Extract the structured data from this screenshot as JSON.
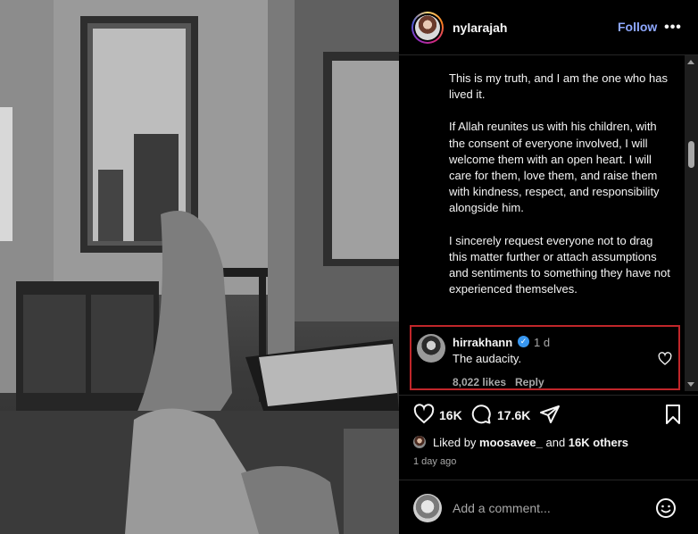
{
  "post": {
    "username": "nylarajah",
    "follow_label": "Follow",
    "more_label": "•••",
    "caption": [
      "This is my truth, and I am the one who has lived it.",
      "If Allah reunites us with his children, with the consent of everyone involved, I will welcome them with an open heart. I will care for them, love them, and raise them with kindness, respect, and responsibility alongside him.",
      "I sincerely request everyone not to drag this matter further or attach assumptions and sentiments to something they have not experienced themselves."
    ]
  },
  "comment": {
    "username": "hirrakhann",
    "verified_mark": "✓",
    "time": "1 d",
    "text": "The audacity.",
    "likes": "8,022 likes",
    "reply_label": "Reply"
  },
  "actions": {
    "like_count": "16K",
    "comment_count": "17.6K"
  },
  "liked_by": {
    "prefix": "Liked by ",
    "user": "moosavee_",
    "mid": " and ",
    "others": "16K others"
  },
  "date": "1 day ago",
  "add_comment": {
    "placeholder": "Add a comment..."
  },
  "colors": {
    "follow": "#8ea8ff",
    "highlight_border": "#c0262a",
    "verified": "#3897f0"
  },
  "icons": [
    "more-icon",
    "heart-icon",
    "comment-icon",
    "share-icon",
    "bookmark-icon",
    "emoji-icon",
    "verified-icon"
  ]
}
